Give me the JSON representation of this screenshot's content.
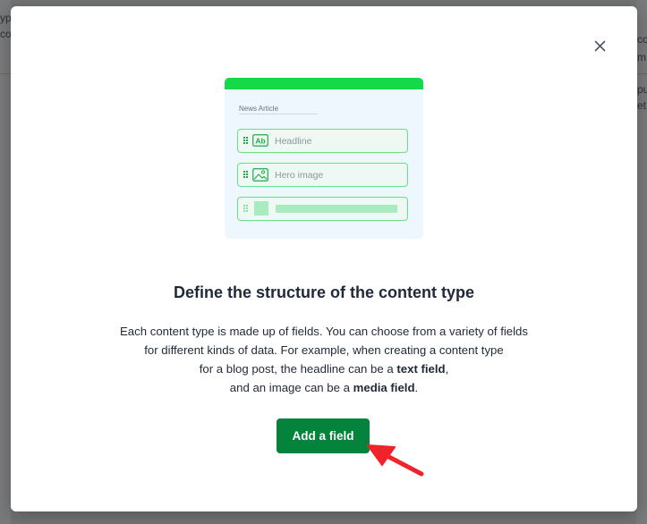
{
  "background": {
    "snippets": [
      "yp",
      "co",
      "co",
      "m",
      "pu",
      "et"
    ]
  },
  "modal": {
    "close_icon": "close-icon",
    "illustration": {
      "title": "News Article",
      "fields": [
        {
          "label": "Headline",
          "icon": "text-ab-icon"
        },
        {
          "label": "Hero image",
          "icon": "image-icon"
        },
        {
          "label": "",
          "icon": "placeholder-icon"
        }
      ],
      "accent_color": "#16d94a"
    },
    "heading": "Define the structure of the content type",
    "description": {
      "line1": "Each content type is made up of fields. You can choose from a variety of fields",
      "line2": "for different kinds of data. For example, when creating a content type",
      "line3_pre": "for a blog post, the headline can be a ",
      "line3_bold": "text field",
      "line3_post": ",",
      "line4_pre": "and an image can be a ",
      "line4_bold": "media field",
      "line4_post": "."
    },
    "add_button_label": "Add a field",
    "button_color": "#03833b",
    "pointer_arrow_color": "#f0232b"
  }
}
